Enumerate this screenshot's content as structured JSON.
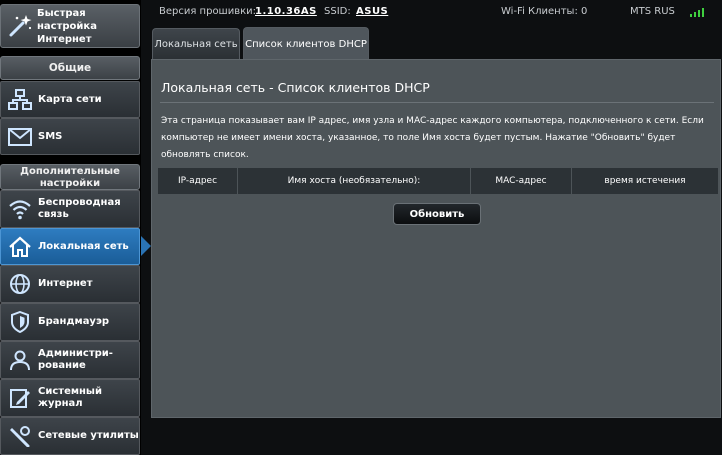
{
  "sidebar": {
    "quick_setup": "Быстрая настройка Интернет",
    "general_header": "Общие",
    "advanced_header": "Дополнительные настройки",
    "items": [
      {
        "label": "Карта сети",
        "icon": "network-map-icon"
      },
      {
        "label": "SMS",
        "icon": "envelope-icon"
      },
      {
        "label": "Беспроводная связь",
        "icon": "wireless-icon"
      },
      {
        "label": "Локальная сеть",
        "icon": "home-icon",
        "active": true
      },
      {
        "label": "Интернет",
        "icon": "globe-icon"
      },
      {
        "label": "Брандмауэр",
        "icon": "shield-icon"
      },
      {
        "label": "Администри-рование",
        "icon": "admin-user-icon"
      },
      {
        "label": "Системный журнал",
        "icon": "log-edit-icon"
      },
      {
        "label": "Сетевые утилиты",
        "icon": "tools-icon"
      }
    ]
  },
  "topbar": {
    "firmware_label": "Версия прошивки:",
    "firmware_value": "1.10.36AS",
    "ssid_label": "SSID:",
    "ssid_value": "ASUS",
    "wifi_clients": "Wi-Fi Клиенты: 0",
    "operator": "MTS RUS",
    "signal_color": "#3fcf3f"
  },
  "tabs": [
    {
      "label": "Локальная сеть",
      "selected": false
    },
    {
      "label": "Список клиентов DHCP",
      "selected": true
    }
  ],
  "main": {
    "title": "Локальная сеть - Список клиентов DHCP",
    "description": "Эта страница показывает вам IP адрес, имя узла и MAC-адрес каждого компьютера, подключенного к сети. Если компьютер не имеет имени хоста, указанное, то поле Имя хоста будет пустым. Нажатие \"Обновить\" будет обновлять список.",
    "table_headers": [
      "IP-адрес",
      "Имя хоста (необязательно):",
      "MAC-адрес",
      "время истечения"
    ],
    "refresh_button": "Обновить"
  }
}
